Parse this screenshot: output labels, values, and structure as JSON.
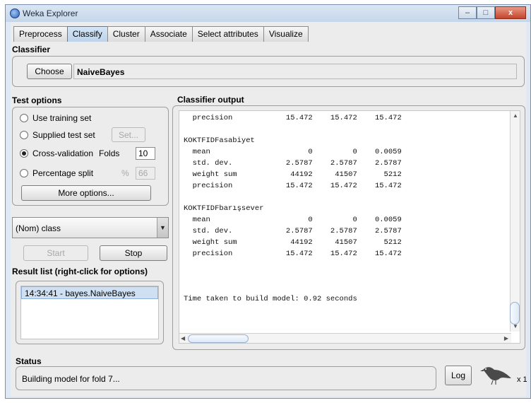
{
  "window": {
    "title": "Weka Explorer",
    "minimize": "–",
    "maximize": "□",
    "close": "x"
  },
  "tabs": [
    "Preprocess",
    "Classify",
    "Cluster",
    "Associate",
    "Select attributes",
    "Visualize"
  ],
  "active_tab": "Classify",
  "classifier": {
    "section_label": "Classifier",
    "choose_label": "Choose",
    "name": "NaiveBayes"
  },
  "test_options": {
    "section_label": "Test options",
    "use_training": "Use training set",
    "supplied_test": "Supplied test set",
    "set_label": "Set...",
    "cross_validation": "Cross-validation",
    "folds_label": "Folds",
    "folds_value": "10",
    "percentage_split": "Percentage split",
    "percent_symbol": "%",
    "percent_value": "66",
    "more_options": "More options...",
    "selected": "Cross-validation"
  },
  "class_select": {
    "value": "(Nom) class"
  },
  "actions": {
    "start": "Start",
    "stop": "Stop"
  },
  "result_list": {
    "section_label": "Result list (right-click for options)",
    "items": [
      "14:34:41 - bayes.NaiveBayes"
    ]
  },
  "output": {
    "section_label": "Classifier output",
    "lines": [
      "  precision            15.472    15.472    15.472",
      "",
      "KOKTFIDFasabiyet",
      "  mean                      0         0    0.0059",
      "  std. dev.            2.5787    2.5787    2.5787",
      "  weight sum            44192     41507      5212",
      "  precision            15.472    15.472    15.472",
      "",
      "KOKTFIDFbarışsever",
      "  mean                      0         0    0.0059",
      "  std. dev.            2.5787    2.5787    2.5787",
      "  weight sum            44192     41507      5212",
      "  precision            15.472    15.472    15.472",
      "",
      "",
      "",
      "Time taken to build model: 0.92 seconds"
    ]
  },
  "status": {
    "section_label": "Status",
    "message": "Building model for fold 7...",
    "log_label": "Log",
    "count": "x 1"
  }
}
